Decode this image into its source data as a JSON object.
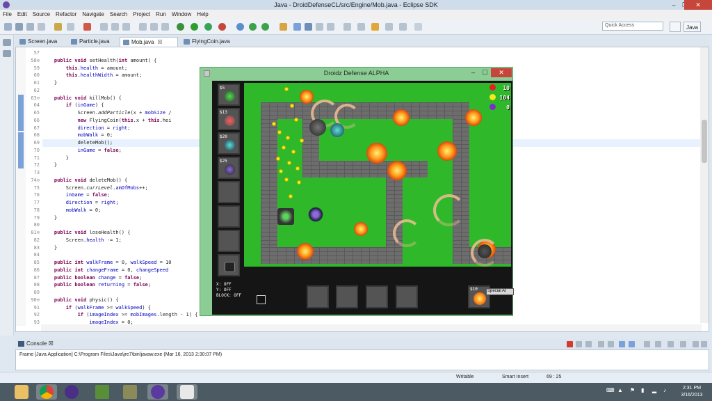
{
  "window": {
    "title": "Java - DroidDefenseCL/src/Engine/Mob.java - Eclipse SDK",
    "minimize": "–",
    "maximize": "❐",
    "close": "✕"
  },
  "menu": [
    "File",
    "Edit",
    "Source",
    "Refactor",
    "Navigate",
    "Search",
    "Project",
    "Run",
    "Window",
    "Help"
  ],
  "toolbar": {
    "quick_access_placeholder": "Quick Access",
    "perspective": "Java"
  },
  "tabs": [
    {
      "label": "Screen.java",
      "active": false
    },
    {
      "label": "Particle.java",
      "active": false
    },
    {
      "label": "Mob.java",
      "active": true,
      "close": "☒"
    },
    {
      "label": "FlyingCoin.java",
      "active": false
    }
  ],
  "editor": {
    "line_numbers": [
      "57",
      "58⊖",
      "59",
      "60",
      "61",
      "62",
      "63⊖",
      "64",
      "65",
      "66",
      "67",
      "68",
      "69",
      "70",
      "71",
      "72",
      "73",
      "74⊖",
      "75",
      "76",
      "77",
      "78",
      "79",
      "80",
      "81⊖",
      "82",
      "83",
      "84",
      "85",
      "86",
      "87",
      "88",
      "89",
      "90⊖",
      "91",
      "92",
      "93"
    ],
    "lines": [
      "",
      "    public void setHealth(int amount) {",
      "        this.health = amount;",
      "        this.healthWidth = amount;",
      "    }",
      "",
      "    public void killMob() {",
      "        if (inGame) {",
      "            Screen.addParticle(x + mobSize /",
      "            new FlyingCoin(this.x + this.hei",
      "            direction = right;",
      "            mobWalk = 0;",
      "            deleteMob();",
      "            inGame = false;",
      "        }",
      "    }",
      "",
      "    public void deleteMob() {",
      "        Screen.currLevel.amOfMobs++;",
      "        inGame = false;",
      "        direction = right;",
      "        mobWalk = 0;",
      "    }",
      "",
      "    public void loseHealth() {",
      "        Screen.health -= 1;",
      "    }",
      "",
      "    public int walkFrame = 0, walkSpeed = 10",
      "    public int changeFrame = 0, changeSpeed",
      "    public boolean change = false;",
      "    public boolean returning = false;",
      "",
      "    public void physic() {",
      "        if (walkFrame >= walkSpeed) {",
      "            if (imageIndex >= mobImages.length - 1) {",
      "                imageIndex = 0;"
    ],
    "highlighted_line": 12
  },
  "console": {
    "tab": "Console",
    "tab_close": "☒",
    "text": "Frame [Java Application] C:\\Program Files\\Java\\jre7\\bin\\javaw.exe (Mar 16, 2013 2:30:07 PM)"
  },
  "status": {
    "writable": "Writable",
    "insert_mode": "Smart Insert",
    "position": "69 : 25"
  },
  "taskbar": {
    "time": "2:31 PM",
    "date": "3/16/2013"
  },
  "game": {
    "title": "Droidz Defense ALPHA",
    "minimize": "–",
    "maximize": "☐",
    "close": "✕",
    "shop": [
      {
        "price": "$5",
        "tower": "green"
      },
      {
        "price": "$13",
        "tower": "red"
      },
      {
        "price": "$20",
        "tower": "teal"
      },
      {
        "price": "$25",
        "tower": "purple"
      },
      {
        "price": "",
        "tower": ""
      },
      {
        "price": "",
        "tower": ""
      },
      {
        "price": "",
        "tower": ""
      },
      {
        "price": "",
        "tower": "trash"
      }
    ],
    "hud": {
      "health": "10",
      "coins": "104",
      "mobs": "0"
    },
    "debug": {
      "x": "X: OFF",
      "y": "Y: OFF",
      "block": "BLOCK: OFF"
    },
    "special": {
      "price": "$10",
      "tooltip": "Special At"
    },
    "colors": {
      "grass": "#2fb92a",
      "path": "#6d6d6d",
      "panel": "#151515"
    }
  }
}
